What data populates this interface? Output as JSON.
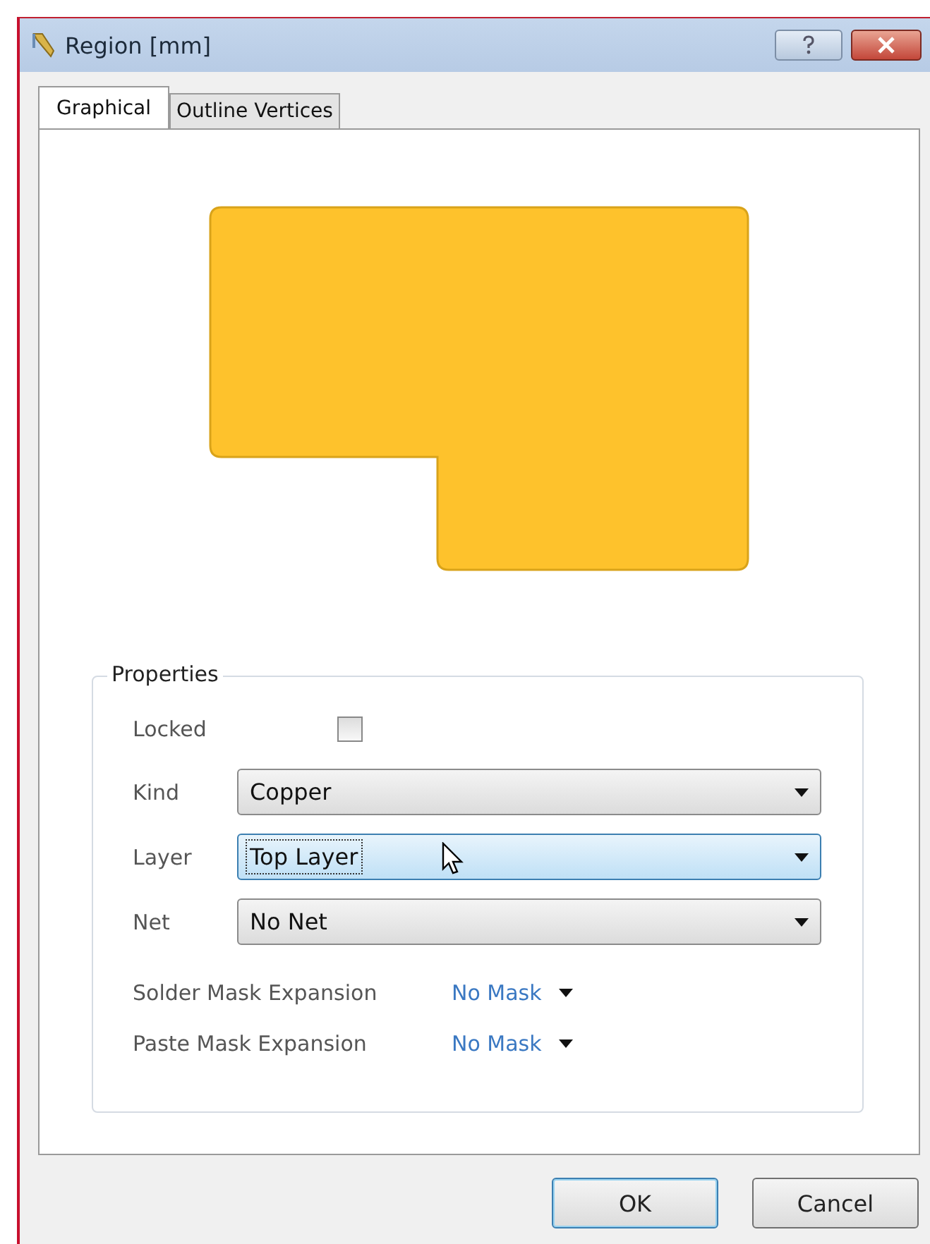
{
  "window": {
    "title": "Region [mm]"
  },
  "tabs": [
    {
      "label": "Graphical",
      "selected": true
    },
    {
      "label": "Outline Vertices",
      "selected": false
    }
  ],
  "properties": {
    "title": "Properties",
    "locked": {
      "label": "Locked",
      "checked": false
    },
    "selects": [
      {
        "label": "Kind",
        "value": "Copper",
        "focused": false
      },
      {
        "label": "Layer",
        "value": "Top Layer",
        "focused": true
      },
      {
        "label": "Net",
        "value": "No Net",
        "focused": false
      }
    ],
    "masks": [
      {
        "label": "Solder Mask Expansion",
        "value": "No Mask"
      },
      {
        "label": "Paste Mask Expansion",
        "value": "No Mask"
      }
    ]
  },
  "buttons": [
    {
      "label": "OK",
      "default": true
    },
    {
      "label": "Cancel",
      "default": false
    }
  ]
}
